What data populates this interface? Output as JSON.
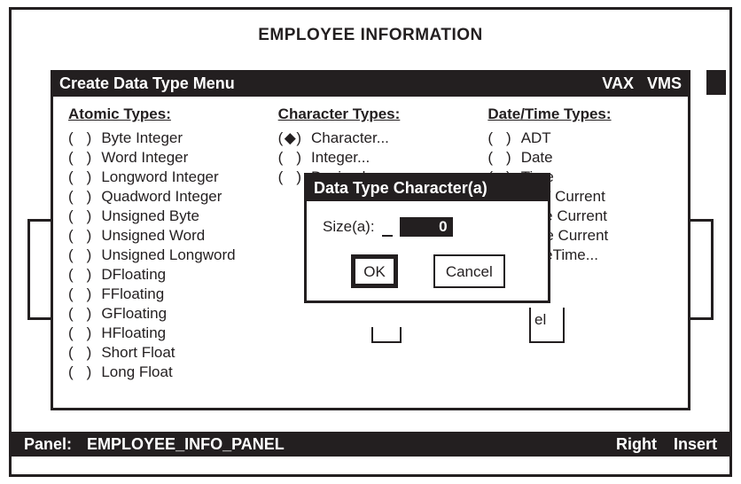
{
  "app_title": "EMPLOYEE INFORMATION",
  "menu": {
    "title": "Create Data Type Menu",
    "system1": "VAX",
    "system2": "VMS"
  },
  "columns": {
    "atomic": {
      "header": "Atomic Types:",
      "items": [
        "Byte Integer",
        "Word Integer",
        "Longword Integer",
        "Quadword Integer",
        "Unsigned Byte",
        "Unsigned Word",
        "Unsigned Longword",
        "DFloating",
        "FFloating",
        "GFloating",
        "HFloating",
        "Short Float",
        "Long Float"
      ]
    },
    "character": {
      "header": "Character Types:",
      "items": [
        "Character...",
        "Integer...",
        "Decimal..."
      ],
      "selected_index": 0
    },
    "datetime": {
      "header": "Date/Time Types:",
      "items": [
        "ADT",
        "Date",
        "Time",
        "ADT Current",
        "Date Current",
        "Time Current",
        "DateTime..."
      ]
    }
  },
  "dialog": {
    "title": "Data Type Character(a)",
    "size_label": "Size(a):",
    "size_value": "0",
    "ok_label": "OK",
    "cancel_label": "Cancel"
  },
  "behind_cancel_fragment": "el",
  "status": {
    "panel_label": "Panel:",
    "panel_name": "EMPLOYEE_INFO_PANEL",
    "mode1": "Right",
    "mode2": "Insert"
  }
}
